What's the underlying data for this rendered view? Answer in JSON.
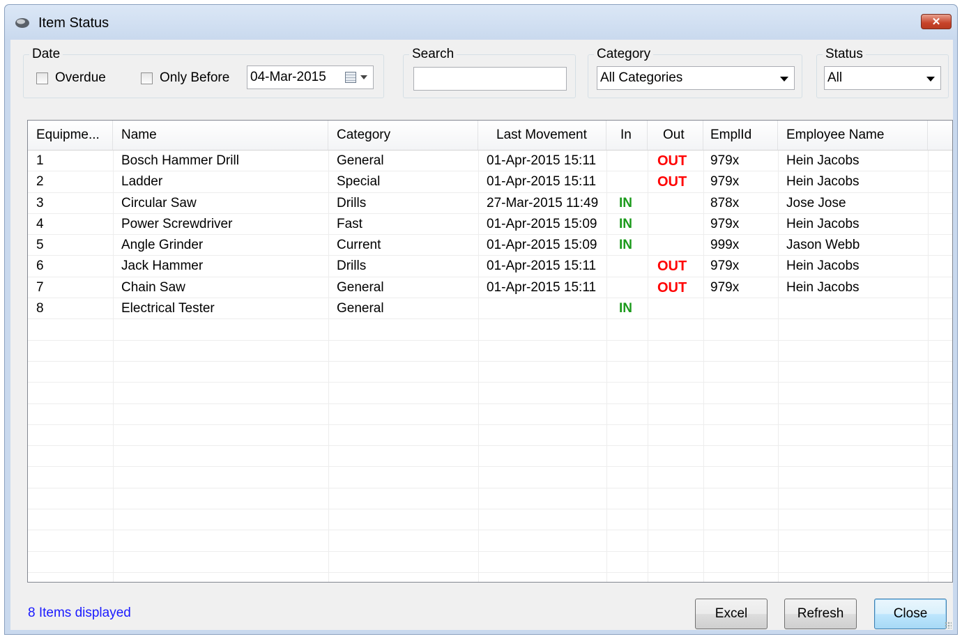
{
  "window": {
    "title": "Item Status",
    "close_glyph": "✕"
  },
  "filters": {
    "date": {
      "legend": "Date",
      "overdue_label": "Overdue",
      "only_before_label": "Only Before",
      "date_value": "04-Mar-2015"
    },
    "search": {
      "legend": "Search",
      "value": ""
    },
    "category": {
      "legend": "Category",
      "selected": "All Categories"
    },
    "status": {
      "legend": "Status",
      "selected": "All"
    }
  },
  "table": {
    "columns": [
      "Equipme...",
      "Name",
      "Category",
      "Last Movement",
      "In",
      "Out",
      "EmplId",
      "Employee Name"
    ],
    "rows": [
      {
        "id": "1",
        "name": "Bosch Hammer Drill",
        "category": "General",
        "last_movement": "01-Apr-2015 15:11",
        "in": "",
        "out": "OUT",
        "emplid": "979x",
        "employee": "Hein Jacobs"
      },
      {
        "id": "2",
        "name": "Ladder",
        "category": "Special",
        "last_movement": "01-Apr-2015 15:11",
        "in": "",
        "out": "OUT",
        "emplid": "979x",
        "employee": "Hein Jacobs"
      },
      {
        "id": "3",
        "name": "Circular Saw",
        "category": "Drills",
        "last_movement": "27-Mar-2015 11:49",
        "in": "IN",
        "out": "",
        "emplid": "878x",
        "employee": "Jose Jose"
      },
      {
        "id": "4",
        "name": "Power Screwdriver",
        "category": "Fast",
        "last_movement": "01-Apr-2015 15:09",
        "in": "IN",
        "out": "",
        "emplid": "979x",
        "employee": "Hein Jacobs"
      },
      {
        "id": "5",
        "name": "Angle Grinder",
        "category": "Current",
        "last_movement": "01-Apr-2015 15:09",
        "in": "IN",
        "out": "",
        "emplid": "999x",
        "employee": "Jason Webb"
      },
      {
        "id": "6",
        "name": "Jack Hammer",
        "category": "Drills",
        "last_movement": "01-Apr-2015 15:11",
        "in": "",
        "out": "OUT",
        "emplid": "979x",
        "employee": "Hein Jacobs"
      },
      {
        "id": "7",
        "name": "Chain Saw",
        "category": "General",
        "last_movement": "01-Apr-2015 15:11",
        "in": "",
        "out": "OUT",
        "emplid": "979x",
        "employee": "Hein Jacobs"
      },
      {
        "id": "8",
        "name": "Electrical Tester",
        "category": "General",
        "last_movement": "",
        "in": "IN",
        "out": "",
        "emplid": "",
        "employee": ""
      }
    ]
  },
  "footer": {
    "items_displayed": "8 Items displayed",
    "excel_label": "Excel",
    "refresh_label": "Refresh",
    "close_label": "Close"
  },
  "colors": {
    "in": "#1b9a1b",
    "out": "#ff0000",
    "link": "#1a1aff"
  }
}
